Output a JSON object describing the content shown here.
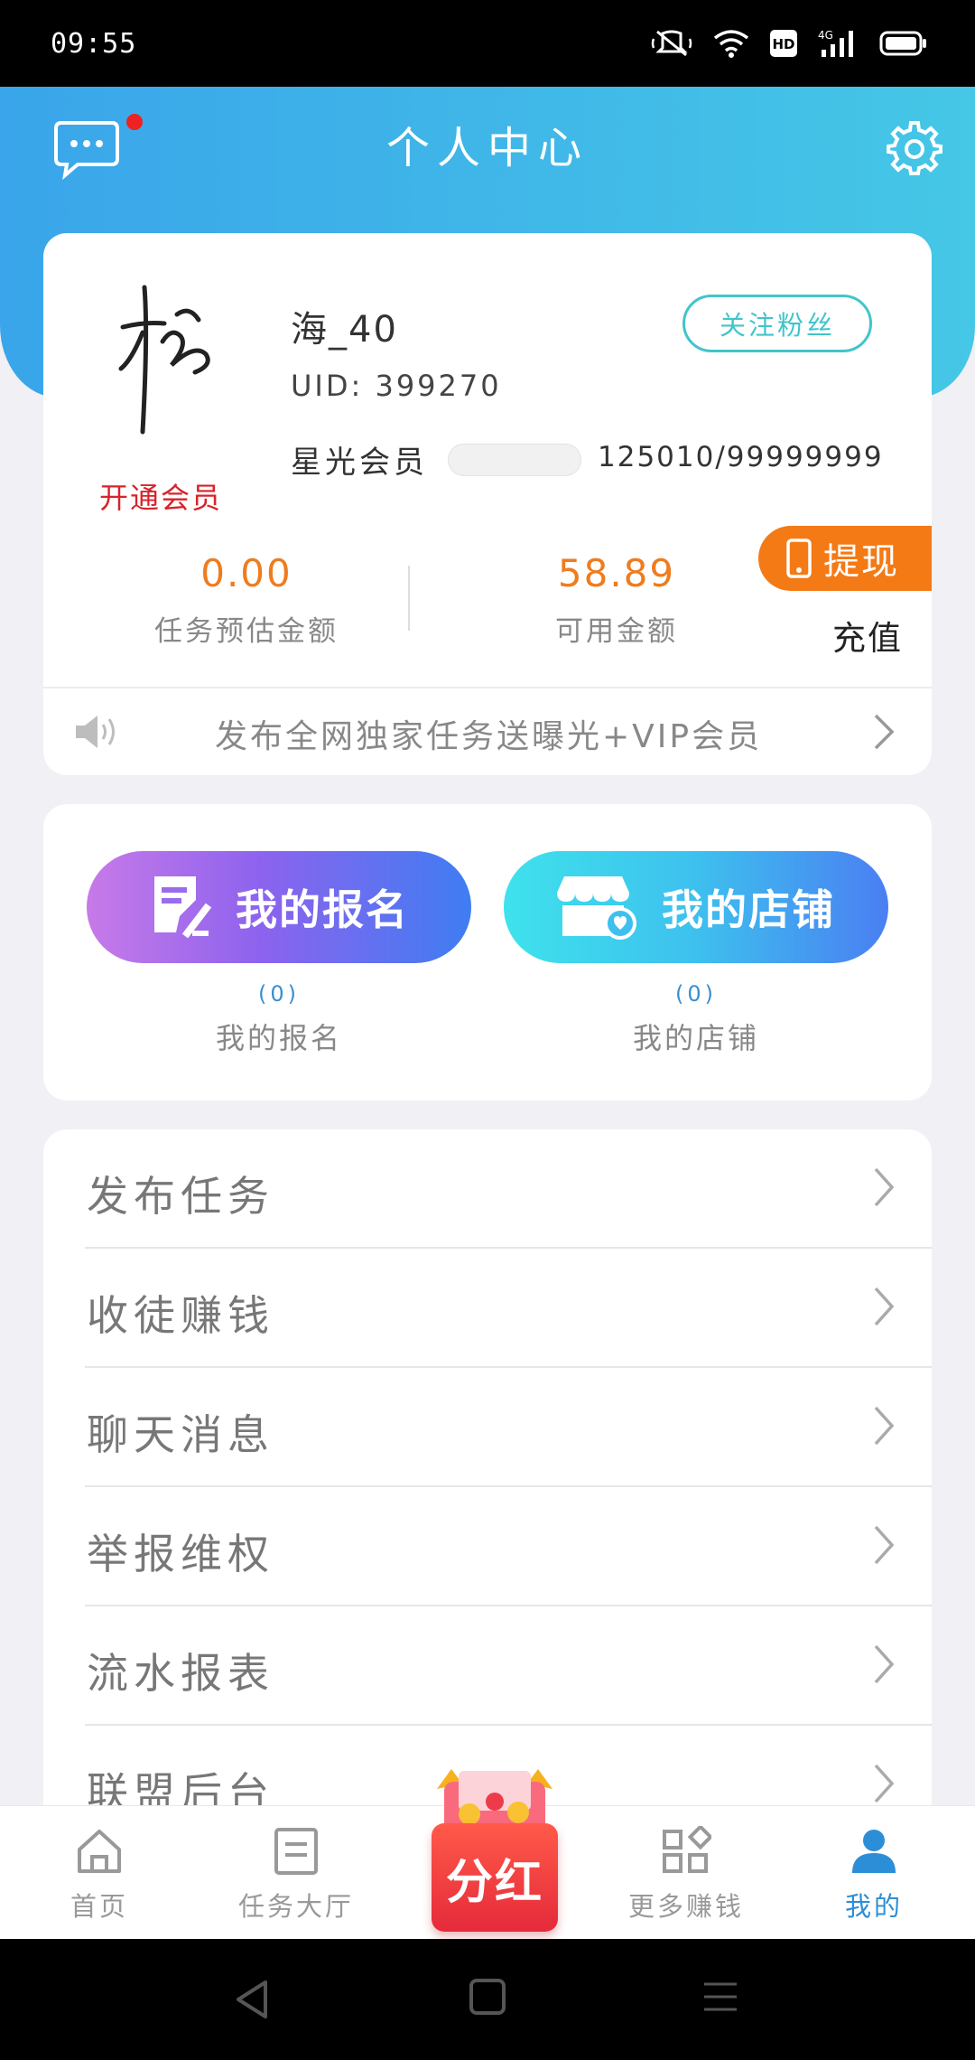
{
  "status_bar": {
    "time": "09:55"
  },
  "header": {
    "title": "个人中心"
  },
  "profile": {
    "nickname": "海_40",
    "uid": "UID: 399270",
    "open_vip": "开通会员",
    "follow_label": "关注粉丝",
    "star_label": "星光会员",
    "star_value": "125010/99999999",
    "estimated_amount": "0.00",
    "estimated_label": "任务预估金额",
    "available_amount": "58.89",
    "available_label": "可用金额",
    "withdraw_label": "提现",
    "recharge_label": "充值",
    "notice": "发布全网独家任务送曝光+VIP会员"
  },
  "quick_actions": [
    {
      "label": "我的报名",
      "count": "(0)",
      "caption": "我的报名"
    },
    {
      "label": "我的店铺",
      "count": "(0)",
      "caption": "我的店铺"
    }
  ],
  "menu": [
    {
      "label": "发布任务"
    },
    {
      "label": "收徒赚钱"
    },
    {
      "label": "聊天消息"
    },
    {
      "label": "举报维权"
    },
    {
      "label": "流水报表"
    },
    {
      "label": "联盟后台"
    }
  ],
  "bottom_nav": {
    "items": [
      {
        "label": "首页",
        "icon": "home-icon"
      },
      {
        "label": "任务大厅",
        "icon": "document-icon"
      },
      {
        "label": "更多赚钱",
        "icon": "apps-icon"
      },
      {
        "label": "我的",
        "icon": "person-icon"
      }
    ],
    "center_badge": "分红",
    "active": "我的"
  },
  "colors": {
    "header_gradient_start": "#3aa5ea",
    "header_gradient_end": "#45c7e6",
    "amount": "#ef7c1e",
    "withdraw": "#f47a16",
    "follow": "#41c5ca",
    "active_nav": "#2c8ed6",
    "vip_red": "#d8232a"
  }
}
